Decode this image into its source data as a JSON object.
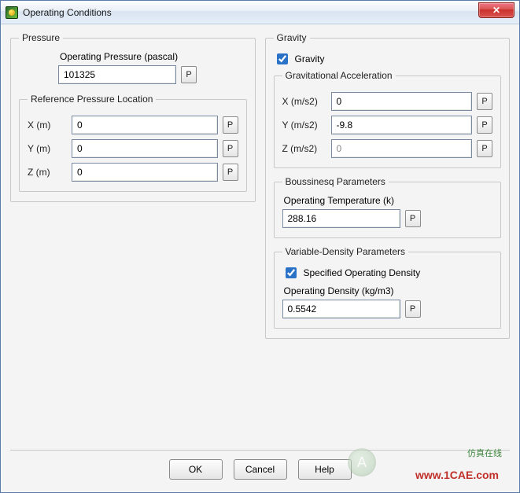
{
  "window": {
    "title": "Operating Conditions",
    "close_glyph": "✕"
  },
  "pressure": {
    "legend": "Pressure",
    "op_pressure_label": "Operating Pressure (pascal)",
    "op_pressure_value": "101325",
    "ref_loc_legend": "Reference Pressure Location",
    "x_label": "X (m)",
    "x_value": "0",
    "y_label": "Y (m)",
    "y_value": "0",
    "z_label": "Z (m)",
    "z_value": "0"
  },
  "gravity": {
    "legend": "Gravity",
    "checkbox_label": "Gravity",
    "checked": true,
    "accel_legend": "Gravitational Acceleration",
    "x_label": "X (m/s2)",
    "x_value": "0",
    "y_label": "Y (m/s2)",
    "y_value": "-9.8",
    "z_label": "Z (m/s2)",
    "z_value": "0"
  },
  "boussinesq": {
    "legend": "Boussinesq Parameters",
    "temp_label": "Operating Temperature (k)",
    "temp_value": "288.16"
  },
  "vardensity": {
    "legend": "Variable-Density Parameters",
    "checkbox_label": "Specified Operating Density",
    "checked": true,
    "density_label": "Operating Density (kg/m3)",
    "density_value": "0.5542"
  },
  "buttons": {
    "ok": "OK",
    "cancel": "Cancel",
    "help": "Help",
    "p_glyph": "P"
  },
  "watermark": {
    "brand": "仿真在线",
    "url": "www.1CAE.com",
    "logo_letter": "A"
  }
}
